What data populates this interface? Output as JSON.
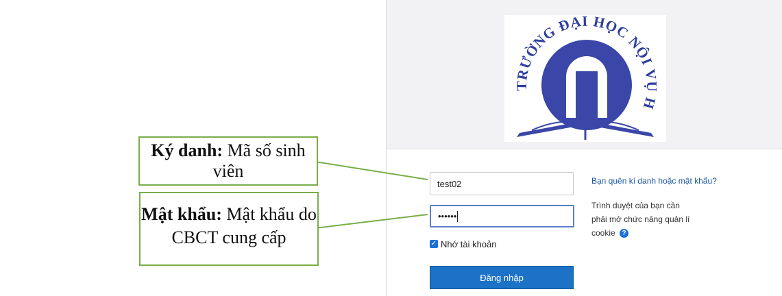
{
  "login": {
    "username_value": "test02",
    "password_value": "••••••",
    "remember_label": "Nhớ tài khoản",
    "remember_checked": true,
    "login_button": "Đăng nhập",
    "forgot_link": "Bạn quên kí danh hoặc mật khẩu?",
    "cookie_notice": "Trình duyệt của bạn cần phải mở chức năng quản lí cookie",
    "help_icon": "question-circle-icon"
  },
  "logo": {
    "text": "TRƯỜNG ĐẠI HỌC NỘI VỤ HÀ NỘI",
    "color": "#2f3f9e"
  },
  "annotations": [
    {
      "term": "Ký danh:",
      "desc": "Mã số sinh viên"
    },
    {
      "term": "Mật khẩu:",
      "desc": "Mật khẩu do CBCT cung cấp"
    }
  ],
  "colors": {
    "callout_border": "#79ad49",
    "button_bg": "#1c72c6",
    "link": "#1a5aa6"
  }
}
